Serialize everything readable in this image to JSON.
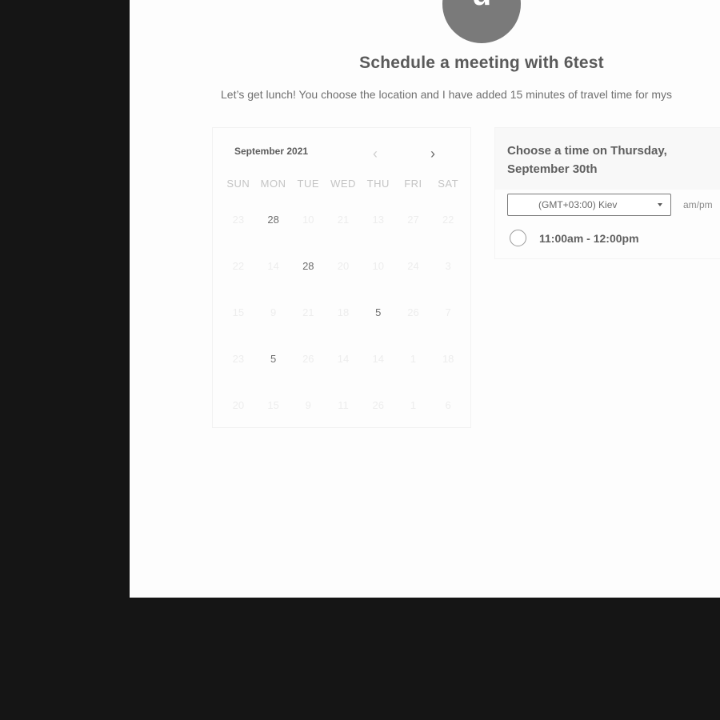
{
  "avatar": {
    "initial": "u"
  },
  "header": {
    "title": "Schedule a meeting with 6test",
    "description": "Let’s get lunch! You choose the location and I have added 15 minutes of travel time for mys"
  },
  "calendar": {
    "month_label": "September 2021",
    "prev_icon": "‹",
    "next_icon": "›",
    "weekdays": [
      "SUN",
      "MON",
      "TUE",
      "WED",
      "THU",
      "FRI",
      "SAT"
    ],
    "rows": [
      [
        {
          "d": "23",
          "active": false
        },
        {
          "d": "28",
          "active": true
        },
        {
          "d": "10",
          "active": false
        },
        {
          "d": "21",
          "active": false
        },
        {
          "d": "13",
          "active": false
        },
        {
          "d": "27",
          "active": false
        },
        {
          "d": "22",
          "active": false
        }
      ],
      [
        {
          "d": "22",
          "active": false
        },
        {
          "d": "14",
          "active": false
        },
        {
          "d": "28",
          "active": true
        },
        {
          "d": "20",
          "active": false
        },
        {
          "d": "10",
          "active": false
        },
        {
          "d": "24",
          "active": false
        },
        {
          "d": "3",
          "active": false
        }
      ],
      [
        {
          "d": "15",
          "active": false
        },
        {
          "d": "9",
          "active": false
        },
        {
          "d": "21",
          "active": false
        },
        {
          "d": "18",
          "active": false
        },
        {
          "d": "5",
          "active": true
        },
        {
          "d": "26",
          "active": false
        },
        {
          "d": "7",
          "active": false
        }
      ],
      [
        {
          "d": "23",
          "active": false
        },
        {
          "d": "5",
          "active": true
        },
        {
          "d": "26",
          "active": false
        },
        {
          "d": "14",
          "active": false
        },
        {
          "d": "14",
          "active": false
        },
        {
          "d": "1",
          "active": false
        },
        {
          "d": "18",
          "active": false
        }
      ],
      [
        {
          "d": "20",
          "active": false
        },
        {
          "d": "15",
          "active": false
        },
        {
          "d": "9",
          "active": false
        },
        {
          "d": "11",
          "active": false
        },
        {
          "d": "26",
          "active": false
        },
        {
          "d": "1",
          "active": false
        },
        {
          "d": "6",
          "active": false
        }
      ]
    ]
  },
  "time_panel": {
    "heading": "Choose a time on Thursday, September 30th",
    "timezone_value": "(GMT+03:00) Kiev",
    "ampm_label": "am/pm",
    "slots": [
      "11:00am - 12:00pm"
    ]
  }
}
